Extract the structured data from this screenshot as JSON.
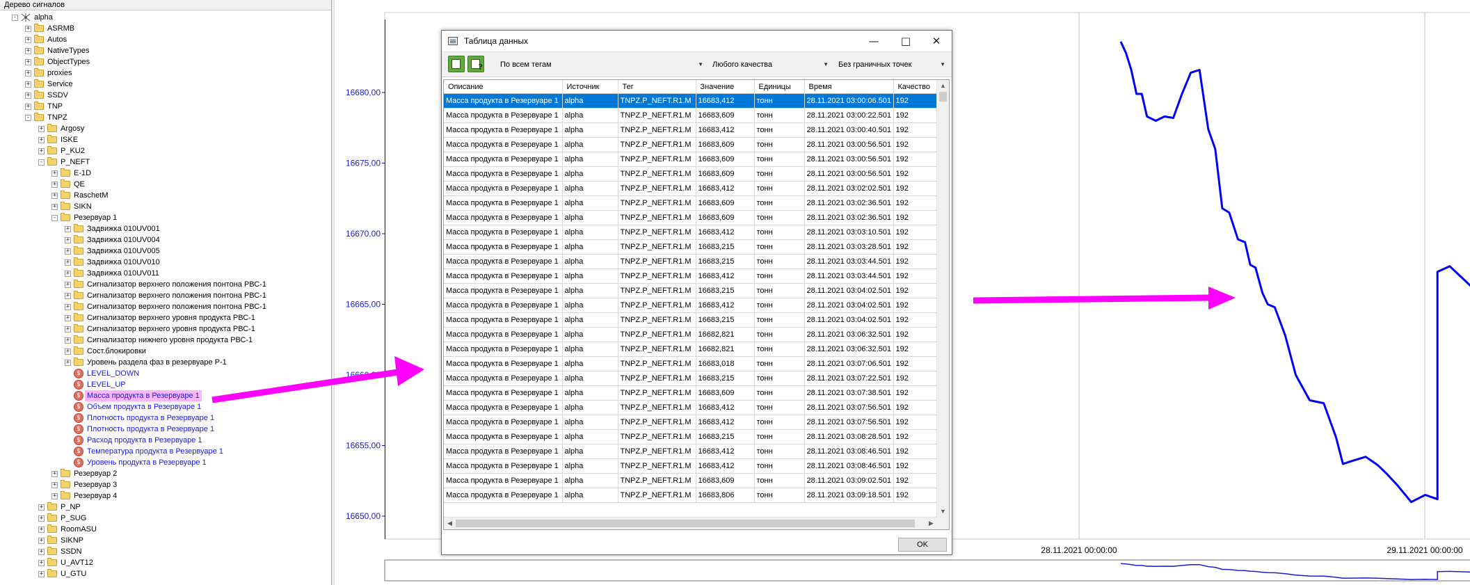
{
  "tree": {
    "header": "Дерево сигналов",
    "nodes": [
      {
        "label": "alpha",
        "level": 0,
        "type": "net",
        "exp": "-"
      },
      {
        "label": "ASRMB",
        "level": 1,
        "type": "folder",
        "exp": "+"
      },
      {
        "label": "Autos",
        "level": 1,
        "type": "folder",
        "exp": "+"
      },
      {
        "label": "NativeTypes",
        "level": 1,
        "type": "folder",
        "exp": "+"
      },
      {
        "label": "ObjectTypes",
        "level": 1,
        "type": "folder",
        "exp": "+"
      },
      {
        "label": "proxies",
        "level": 1,
        "type": "folder",
        "exp": "+"
      },
      {
        "label": "Service",
        "level": 1,
        "type": "folder",
        "exp": "+"
      },
      {
        "label": "SSDV",
        "level": 1,
        "type": "folder",
        "exp": "+"
      },
      {
        "label": "TNP",
        "level": 1,
        "type": "folder",
        "exp": "+"
      },
      {
        "label": "TNPZ",
        "level": 1,
        "type": "folder",
        "exp": "-"
      },
      {
        "label": "Argosy",
        "level": 2,
        "type": "folder",
        "exp": "+"
      },
      {
        "label": "ISKE",
        "level": 2,
        "type": "folder",
        "exp": "+"
      },
      {
        "label": "P_KU2",
        "level": 2,
        "type": "folder",
        "exp": "+"
      },
      {
        "label": "P_NEFT",
        "level": 2,
        "type": "folder",
        "exp": "-"
      },
      {
        "label": "E-1D",
        "level": 3,
        "type": "folder",
        "exp": "+"
      },
      {
        "label": "QE",
        "level": 3,
        "type": "folder",
        "exp": "+"
      },
      {
        "label": "RaschetM",
        "level": 3,
        "type": "folder",
        "exp": "+"
      },
      {
        "label": "SIKN",
        "level": 3,
        "type": "folder",
        "exp": "+"
      },
      {
        "label": "Резервуар 1",
        "level": 3,
        "type": "folder",
        "exp": "-"
      },
      {
        "label": "Задвижка 010UV001",
        "level": 4,
        "type": "folder",
        "exp": "+"
      },
      {
        "label": "Задвижка 010UV004",
        "level": 4,
        "type": "folder",
        "exp": "+"
      },
      {
        "label": "Задвижка 010UV005",
        "level": 4,
        "type": "folder",
        "exp": "+"
      },
      {
        "label": "Задвижка 010UV010",
        "level": 4,
        "type": "folder",
        "exp": "+"
      },
      {
        "label": "Задвижка 010UV011",
        "level": 4,
        "type": "folder",
        "exp": "+"
      },
      {
        "label": "Сигнализатор верхнего положения понтона РВС-1",
        "level": 4,
        "type": "folder",
        "exp": "+"
      },
      {
        "label": "Сигнализатор верхнего положения понтона РВС-1",
        "level": 4,
        "type": "folder",
        "exp": "+"
      },
      {
        "label": "Сигнализатор верхнего положения понтона РВС-1",
        "level": 4,
        "type": "folder",
        "exp": "+"
      },
      {
        "label": "Сигнализатор верхнего уровня продукта РВС-1",
        "level": 4,
        "type": "folder",
        "exp": "+"
      },
      {
        "label": "Сигнализатор верхнего уровня продукта РВС-1",
        "level": 4,
        "type": "folder",
        "exp": "+"
      },
      {
        "label": "Сигнализатор нижнего уровня продукта РВС-1",
        "level": 4,
        "type": "folder",
        "exp": "+"
      },
      {
        "label": "Сост.блокировки",
        "level": 4,
        "type": "folder",
        "exp": "+"
      },
      {
        "label": "Уровень раздела фаз  в резервуаре Р-1",
        "level": 4,
        "type": "folder",
        "exp": "+"
      },
      {
        "label": "LEVEL_DOWN",
        "level": 4,
        "type": "signal",
        "exp": ""
      },
      {
        "label": "LEVEL_UP",
        "level": 4,
        "type": "signal",
        "exp": ""
      },
      {
        "label": "Масса продукта в Резервуаре 1",
        "level": 4,
        "type": "signal",
        "exp": "",
        "selected": true
      },
      {
        "label": "Объем продукта в Резервуаре 1",
        "level": 4,
        "type": "signal",
        "exp": ""
      },
      {
        "label": "Плотность продукта в Резервуаре 1",
        "level": 4,
        "type": "signal",
        "exp": ""
      },
      {
        "label": "Плотность продукта в Резервуаре 1",
        "level": 4,
        "type": "signal",
        "exp": ""
      },
      {
        "label": "Расход продукта в Резервуаре 1",
        "level": 4,
        "type": "signal",
        "exp": ""
      },
      {
        "label": "Температура продукта в Резервуаре 1",
        "level": 4,
        "type": "signal",
        "exp": ""
      },
      {
        "label": "Уровень продукта в Резервуаре 1",
        "level": 4,
        "type": "signal",
        "exp": ""
      },
      {
        "label": "Резервуар 2",
        "level": 3,
        "type": "folder",
        "exp": "+"
      },
      {
        "label": "Резервуар 3",
        "level": 3,
        "type": "folder",
        "exp": "+"
      },
      {
        "label": "Резервуар 4",
        "level": 3,
        "type": "folder",
        "exp": "+"
      },
      {
        "label": "P_NP",
        "level": 2,
        "type": "folder",
        "exp": "+"
      },
      {
        "label": "P_SUG",
        "level": 2,
        "type": "folder",
        "exp": "+"
      },
      {
        "label": "RoomASU",
        "level": 2,
        "type": "folder",
        "exp": "+"
      },
      {
        "label": "SIKNP",
        "level": 2,
        "type": "folder",
        "exp": "+"
      },
      {
        "label": "SSDN",
        "level": 2,
        "type": "folder",
        "exp": "+"
      },
      {
        "label": "U_AVT12",
        "level": 2,
        "type": "folder",
        "exp": "+"
      },
      {
        "label": "U_GTU",
        "level": 2,
        "type": "folder",
        "exp": "+"
      }
    ]
  },
  "chart_data": {
    "type": "line",
    "y_ticks": [
      "16680,00",
      "16675,00",
      "16670,00",
      "16665,00",
      "16660,00",
      "16655,00",
      "16650,00"
    ],
    "y_values": [
      16680,
      16675,
      16670,
      16665,
      16660,
      16655,
      16650
    ],
    "x_ticks": [
      "28.11.2021 00:00:00",
      "29.11.2021 00:00:00"
    ],
    "series": [
      {
        "color": "#0000ff",
        "points": [
          [
            0.0,
            16683.6
          ],
          [
            0.015,
            16682.8
          ],
          [
            0.03,
            16681.6
          ],
          [
            0.045,
            16679.9
          ],
          [
            0.06,
            16679.9
          ],
          [
            0.075,
            16678.3
          ],
          [
            0.1,
            16678.0
          ],
          [
            0.125,
            16678.3
          ],
          [
            0.15,
            16678.2
          ],
          [
            0.175,
            16679.9
          ],
          [
            0.2,
            16681.4
          ],
          [
            0.225,
            16681.6
          ],
          [
            0.25,
            16677.4
          ],
          [
            0.27,
            16676.0
          ],
          [
            0.29,
            16671.8
          ],
          [
            0.31,
            16671.5
          ],
          [
            0.335,
            16669.6
          ],
          [
            0.355,
            16669.4
          ],
          [
            0.37,
            16667.8
          ],
          [
            0.385,
            16667.6
          ],
          [
            0.405,
            16665.8
          ],
          [
            0.42,
            16665.0
          ],
          [
            0.44,
            16664.8
          ],
          [
            0.47,
            16662.8
          ],
          [
            0.5,
            16660.0
          ],
          [
            0.54,
            16658.2
          ],
          [
            0.58,
            16658.0
          ],
          [
            0.615,
            16655.6
          ],
          [
            0.635,
            16653.7
          ],
          [
            0.66,
            16653.9
          ],
          [
            0.7,
            16654.2
          ],
          [
            0.735,
            16653.6
          ],
          [
            0.76,
            16653.0
          ],
          [
            0.79,
            16652.2
          ],
          [
            0.83,
            16651.0
          ],
          [
            0.87,
            16651.5
          ],
          [
            0.905,
            16651.2
          ],
          [
            0.905,
            16667.3
          ],
          [
            0.94,
            16667.7
          ],
          [
            0.97,
            16667.0
          ],
          [
            1.0,
            16666.3
          ]
        ]
      }
    ]
  },
  "dialog": {
    "title": "Таблица данных",
    "filter_tags": "По всем тегам",
    "filter_quality": "Любого качества",
    "filter_bounds": "Без граничных точек",
    "columns": [
      "Описание",
      "Источник",
      "Тег",
      "Значение",
      "Единицы",
      "Время",
      "Качество"
    ],
    "rows": [
      [
        "Масса продукта в Резервуаре 1",
        "alpha",
        "TNPZ.P_NEFT.R1.M",
        "16683,412",
        "тонн",
        "28.11.2021 03:00:06.501",
        "192"
      ],
      [
        "Масса продукта в Резервуаре 1",
        "alpha",
        "TNPZ.P_NEFT.R1.M",
        "16683,609",
        "тонн",
        "28.11.2021 03:00:22.501",
        "192"
      ],
      [
        "Масса продукта в Резервуаре 1",
        "alpha",
        "TNPZ.P_NEFT.R1.M",
        "16683,412",
        "тонн",
        "28.11.2021 03:00:40.501",
        "192"
      ],
      [
        "Масса продукта в Резервуаре 1",
        "alpha",
        "TNPZ.P_NEFT.R1.M",
        "16683,609",
        "тонн",
        "28.11.2021 03:00:56.501",
        "192"
      ],
      [
        "Масса продукта в Резервуаре 1",
        "alpha",
        "TNPZ.P_NEFT.R1.M",
        "16683,609",
        "тонн",
        "28.11.2021 03:00:56.501",
        "192"
      ],
      [
        "Масса продукта в Резервуаре 1",
        "alpha",
        "TNPZ.P_NEFT.R1.M",
        "16683,609",
        "тонн",
        "28.11.2021 03:00:56.501",
        "192"
      ],
      [
        "Масса продукта в Резервуаре 1",
        "alpha",
        "TNPZ.P_NEFT.R1.M",
        "16683,412",
        "тонн",
        "28.11.2021 03:02:02.501",
        "192"
      ],
      [
        "Масса продукта в Резервуаре 1",
        "alpha",
        "TNPZ.P_NEFT.R1.M",
        "16683,609",
        "тонн",
        "28.11.2021 03:02:36.501",
        "192"
      ],
      [
        "Масса продукта в Резервуаре 1",
        "alpha",
        "TNPZ.P_NEFT.R1.M",
        "16683,609",
        "тонн",
        "28.11.2021 03:02:36.501",
        "192"
      ],
      [
        "Масса продукта в Резервуаре 1",
        "alpha",
        "TNPZ.P_NEFT.R1.M",
        "16683,412",
        "тонн",
        "28.11.2021 03:03:10.501",
        "192"
      ],
      [
        "Масса продукта в Резервуаре 1",
        "alpha",
        "TNPZ.P_NEFT.R1.M",
        "16683,215",
        "тонн",
        "28.11.2021 03:03:28.501",
        "192"
      ],
      [
        "Масса продукта в Резервуаре 1",
        "alpha",
        "TNPZ.P_NEFT.R1.M",
        "16683,215",
        "тонн",
        "28.11.2021 03:03:44.501",
        "192"
      ],
      [
        "Масса продукта в Резервуаре 1",
        "alpha",
        "TNPZ.P_NEFT.R1.M",
        "16683,412",
        "тонн",
        "28.11.2021 03:03:44.501",
        "192"
      ],
      [
        "Масса продукта в Резервуаре 1",
        "alpha",
        "TNPZ.P_NEFT.R1.M",
        "16683,215",
        "тонн",
        "28.11.2021 03:04:02.501",
        "192"
      ],
      [
        "Масса продукта в Резервуаре 1",
        "alpha",
        "TNPZ.P_NEFT.R1.M",
        "16683,412",
        "тонн",
        "28.11.2021 03:04:02.501",
        "192"
      ],
      [
        "Масса продукта в Резервуаре 1",
        "alpha",
        "TNPZ.P_NEFT.R1.M",
        "16683,215",
        "тонн",
        "28.11.2021 03:04:02.501",
        "192"
      ],
      [
        "Масса продукта в Резервуаре 1",
        "alpha",
        "TNPZ.P_NEFT.R1.M",
        "16682,821",
        "тонн",
        "28.11.2021 03:06:32.501",
        "192"
      ],
      [
        "Масса продукта в Резервуаре 1",
        "alpha",
        "TNPZ.P_NEFT.R1.M",
        "16682,821",
        "тонн",
        "28.11.2021 03:06:32.501",
        "192"
      ],
      [
        "Масса продукта в Резервуаре 1",
        "alpha",
        "TNPZ.P_NEFT.R1.M",
        "16683,018",
        "тонн",
        "28.11.2021 03:07:06.501",
        "192"
      ],
      [
        "Масса продукта в Резервуаре 1",
        "alpha",
        "TNPZ.P_NEFT.R1.M",
        "16683,215",
        "тонн",
        "28.11.2021 03:07:22.501",
        "192"
      ],
      [
        "Масса продукта в Резервуаре 1",
        "alpha",
        "TNPZ.P_NEFT.R1.M",
        "16683,609",
        "тонн",
        "28.11.2021 03:07:38.501",
        "192"
      ],
      [
        "Масса продукта в Резервуаре 1",
        "alpha",
        "TNPZ.P_NEFT.R1.M",
        "16683,412",
        "тонн",
        "28.11.2021 03:07:56.501",
        "192"
      ],
      [
        "Масса продукта в Резервуаре 1",
        "alpha",
        "TNPZ.P_NEFT.R1.M",
        "16683,412",
        "тонн",
        "28.11.2021 03:07:56.501",
        "192"
      ],
      [
        "Масса продукта в Резервуаре 1",
        "alpha",
        "TNPZ.P_NEFT.R1.M",
        "16683,215",
        "тонн",
        "28.11.2021 03:08:28.501",
        "192"
      ],
      [
        "Масса продукта в Резервуаре 1",
        "alpha",
        "TNPZ.P_NEFT.R1.M",
        "16683,412",
        "тонн",
        "28.11.2021 03:08:46.501",
        "192"
      ],
      [
        "Масса продукта в Резервуаре 1",
        "alpha",
        "TNPZ.P_NEFT.R1.M",
        "16683,412",
        "тонн",
        "28.11.2021 03:08:46.501",
        "192"
      ],
      [
        "Масса продукта в Резервуаре 1",
        "alpha",
        "TNPZ.P_NEFT.R1.M",
        "16683,609",
        "тонн",
        "28.11.2021 03:09:02.501",
        "192"
      ],
      [
        "Масса продукта в Резервуаре 1",
        "alpha",
        "TNPZ.P_NEFT.R1.M",
        "16683,806",
        "тонн",
        "28.11.2021 03:09:18.501",
        "192"
      ]
    ],
    "selected_row": 0,
    "ok_label": "OK"
  },
  "colors": {
    "accent_selection": "#0078d7",
    "annotation_arrow": "#ff00ff",
    "series_line": "#0000ff",
    "tree_highlight": "#ffb4ff"
  }
}
